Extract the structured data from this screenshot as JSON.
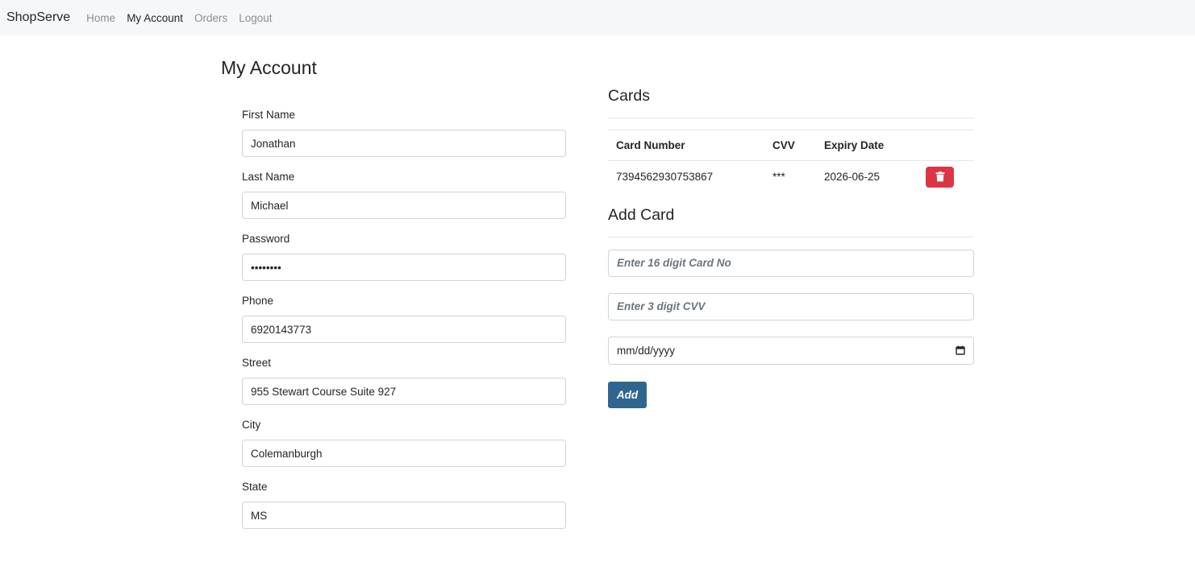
{
  "nav": {
    "brand": "ShopServe",
    "links": [
      {
        "label": "Home",
        "active": false
      },
      {
        "label": "My Account",
        "active": true
      },
      {
        "label": "Orders",
        "active": false
      },
      {
        "label": "Logout",
        "active": false
      }
    ]
  },
  "account": {
    "title": "My Account",
    "fields": [
      {
        "label": "First Name",
        "value": "Jonathan"
      },
      {
        "label": "Last Name",
        "value": "Michael"
      },
      {
        "label": "Password",
        "value": "••••••••"
      },
      {
        "label": "Phone",
        "value": "6920143773"
      },
      {
        "label": "Street",
        "value": "955 Stewart Course Suite 927"
      },
      {
        "label": "City",
        "value": "Colemanburgh"
      },
      {
        "label": "State",
        "value": "MS"
      }
    ]
  },
  "cards": {
    "title": "Cards",
    "columns": [
      "Card Number",
      "CVV",
      "Expiry Date"
    ],
    "rows": [
      {
        "card_number": "7394562930753867",
        "cvv": "***",
        "expiry": "2026-06-25"
      }
    ],
    "delete_icon": "trash-icon",
    "delete_color": "#dc3545"
  },
  "add_card": {
    "title": "Add Card",
    "card_placeholder": "Enter 16 digit Card No",
    "cvv_placeholder": "Enter 3 digit CVV",
    "date_placeholder": "mm/dd/yyyy",
    "date_icon": "calendar-icon",
    "button_label": "Add",
    "button_color": "#2f6690"
  }
}
